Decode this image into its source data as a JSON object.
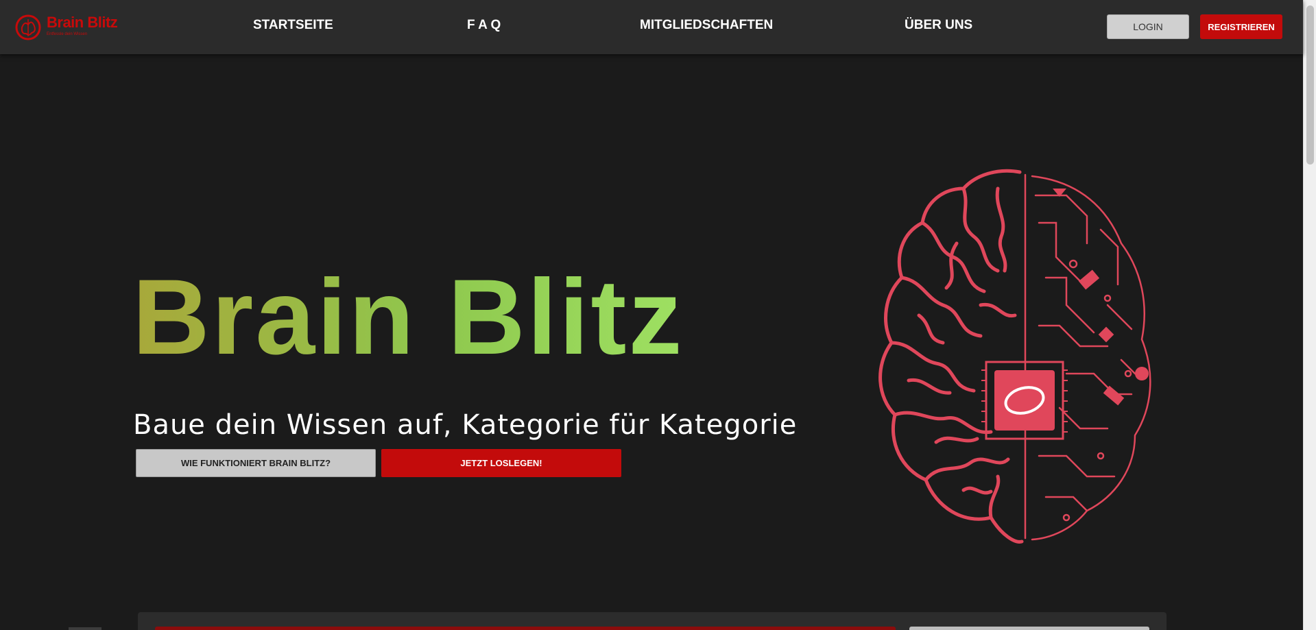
{
  "header": {
    "logo_text": "Brain Blitz",
    "logo_subtitle": "Entfessle dein Wissen",
    "nav": [
      {
        "label": "STARTSEITE"
      },
      {
        "label": "F A Q"
      },
      {
        "label": "MITGLIEDSCHAFTEN"
      },
      {
        "label": "ÜBER UNS"
      }
    ],
    "login_label": "LOGIN",
    "register_label": "REGISTRIEREN"
  },
  "hero": {
    "title": "Brain Blitz",
    "subtitle": "Baue dein Wissen auf, Kategorie für Kategorie",
    "btn_how": "WIE FUNKTIONIERT BRAIN BLITZ?",
    "btn_start": "JETZT LOSLEGEN!"
  },
  "colors": {
    "background": "#1b1b1b",
    "header_bg": "#2b2b2b",
    "accent_red": "#c30b0b",
    "brain_pink": "#e0475b",
    "title_gradient_start": "#a8a83a",
    "title_gradient_end": "#9ee062"
  }
}
